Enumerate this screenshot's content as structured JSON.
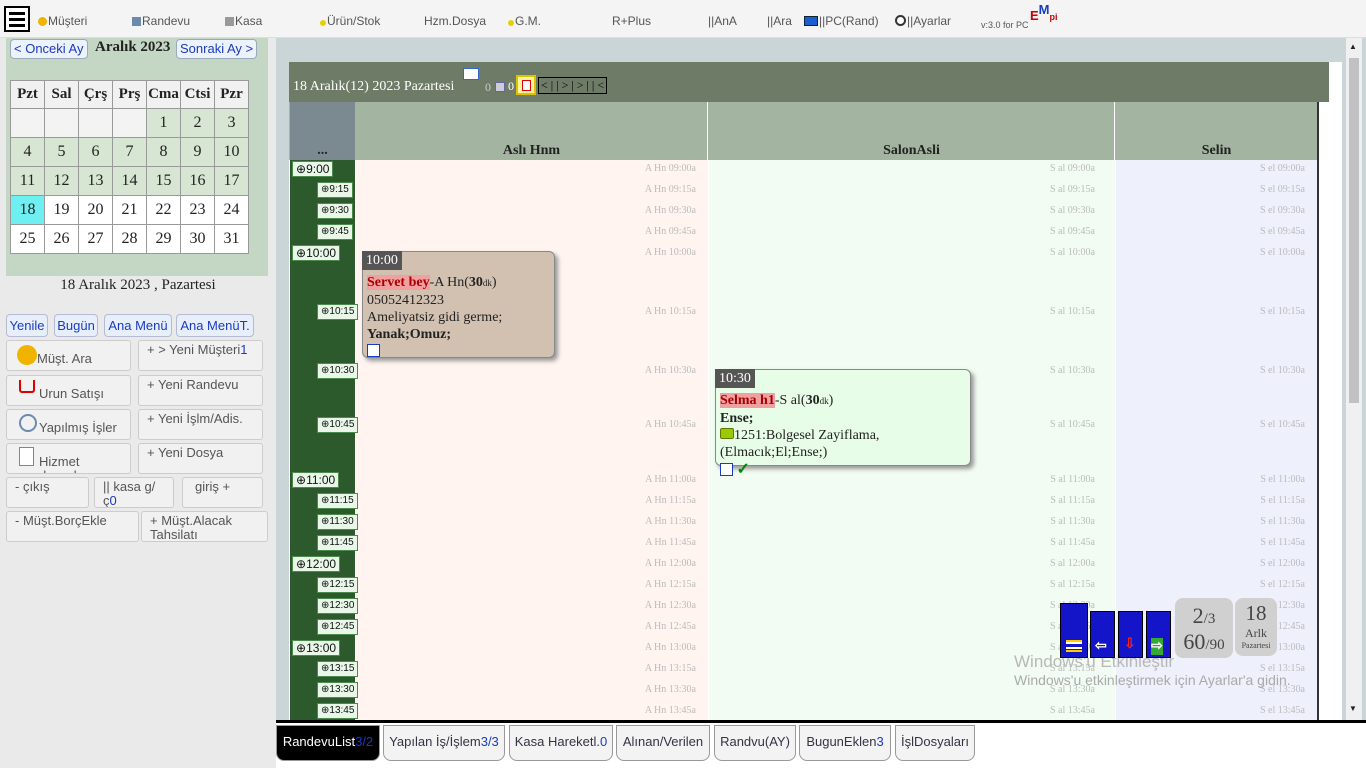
{
  "topbar": {
    "items": [
      "Müşteri",
      "Randevu",
      "Kasa",
      "Ürün/Stok",
      "Hzm.Dosya",
      "G.M.",
      "R+Plus",
      "||AnA",
      "||Ara",
      "||PC(Rand)",
      "||Ayarlar"
    ],
    "version": "v:3.0 for PC",
    "logo": "EMpi"
  },
  "calendar": {
    "prev": "< Onceki Ay",
    "next": "Sonraki Ay >",
    "month_title": "Aralık 2023",
    "weekdays": [
      "Pzt",
      "Sal",
      "Çrş",
      "Prş",
      "Cma",
      "Ctsi",
      "Pzr"
    ],
    "weeks": [
      [
        "",
        "",
        "",
        "",
        "1",
        "2",
        "3"
      ],
      [
        "4",
        "5",
        "6",
        "7",
        "8",
        "9",
        "10"
      ],
      [
        "11",
        "12",
        "13",
        "14",
        "15",
        "16",
        "17"
      ],
      [
        "18",
        "19",
        "20",
        "21",
        "22",
        "23",
        "24"
      ],
      [
        "25",
        "26",
        "27",
        "28",
        "29",
        "30",
        "31"
      ]
    ],
    "selected_date": "18 Aralık 2023 , Pazartesi"
  },
  "left_buttons": {
    "yenile": "Yenile",
    "bugun": "Bugün",
    "ana_menu": "Ana Menü",
    "ana_menu_t": "Ana MenüT.",
    "must_ara": "Müşt. Ara",
    "yeni_musteri": "+ > Yeni Müşteri",
    "yeni_musteri_count": "1",
    "urun_satisi": "Urun Satışı",
    "yeni_randevu": "+ Yeni Randevu",
    "yapilmis_isler": "Yapılmış İşler",
    "yeni_islm": "+ Yeni İşlm/Adis.",
    "hizmet_dosyalari": "Hizmet dosyaları",
    "yeni_dosya": "+ Yeni Dosya",
    "cikis": "- çıkış",
    "kasa_gc": "|| kasa g/ç",
    "kasa_gc_count": "0",
    "giris": "giriş +",
    "must_borc": "- Müşt.BorçEkle",
    "must_alacak": "+ Müşt.Alacak Tahsilatı"
  },
  "day_header": {
    "title": "18 Aralık(12) 2023 Pazartesi",
    "count_a": "0",
    "count_b": "0",
    "nav": "< | | > | > | | <"
  },
  "columns": {
    "corner": "...",
    "staff": [
      "Aslı Hnm",
      "SalonAsli",
      "Selin"
    ]
  },
  "time_slots": [
    "9:00",
    "9:15",
    "9:30",
    "9:45",
    "10:00",
    "10:15",
    "10:30",
    "10:45",
    "11:00",
    "11:15",
    "11:30",
    "11:45",
    "12:00",
    "12:15",
    "12:30",
    "12:45",
    "13:00",
    "13:15",
    "13:30",
    "13:45"
  ],
  "slot_labels": {
    "a": [
      "A Hn 09:00a",
      "A Hn 09:15a",
      "A Hn 09:30a",
      "A Hn 09:45a",
      "A Hn 10:00a",
      "A Hn 10:15a",
      "A Hn 10:30a",
      "A Hn 10:45a",
      "A Hn 11:00a",
      "A Hn 11:15a",
      "A Hn 11:30a",
      "A Hn 11:45a",
      "A Hn 12:00a",
      "A Hn 12:15a",
      "A Hn 12:30a",
      "A Hn 12:45a",
      "A Hn 13:00a",
      "A Hn 13:15a",
      "A Hn 13:30a",
      "A Hn 13:45a"
    ],
    "s": [
      "S al 09:00a",
      "S al 09:15a",
      "S al 09:30a",
      "S al 09:45a",
      "S al 10:00a",
      "S al 10:15a",
      "S al 10:30a",
      "S al 10:45a",
      "S al 11:00a",
      "S al 11:15a",
      "S al 11:30a",
      "S al 11:45a",
      "S al 12:00a",
      "S al 12:15a",
      "S al 12:30a",
      "S al 12:45a",
      "S al 13:00a",
      "S al 13:15a",
      "S al 13:30a",
      "S al 13:45a"
    ],
    "e": [
      "S el 09:00a",
      "S el 09:15a",
      "S el 09:30a",
      "S el 09:45a",
      "S el 10:00a",
      "S el 10:15a",
      "S el 10:30a",
      "S el 10:45a",
      "S el 11:00a",
      "S el 11:15a",
      "S el 11:30a",
      "S el 11:45a",
      "S el 12:00a",
      "S el 12:15a",
      "S el 12:30a",
      "S el 12:45a",
      "S el 13:00a",
      "S el 13:15a",
      "S el 13:30a",
      "S el 13:45a"
    ]
  },
  "appointments": [
    {
      "time": "10:00",
      "name": "Servet bey",
      "suffix": "-A Hn(",
      "duration": "30",
      "unit": "dk",
      "tail": ")",
      "phone": "05052412323",
      "note": "Ameliyatsiz gidi germe;",
      "area": "Yanak;Omuz;",
      "bg": "#d2c0b0"
    },
    {
      "time": "10:30",
      "name": "Selma h1",
      "suffix": "-S al(",
      "duration": "30",
      "unit": "dk",
      "tail": ")",
      "area": "Ense;",
      "service": "1251:Bolgesel Zayiflama,(Elmacık;El;Ense;)",
      "bg": "#e8fde8"
    }
  ],
  "widget": {
    "page": "2",
    "page_total": "/3",
    "progress": "60",
    "progress_total": "/90",
    "day": "18",
    "month": "Arlk",
    "weekday": "Pazartesi"
  },
  "watermark": {
    "line1": "Windows'u Etkinleştir",
    "line2": "Windows'u etkinleştirmek için Ayarlar'a gidin."
  },
  "tabs": [
    {
      "label": "RandevuList",
      "count": "3/2"
    },
    {
      "label": "Yapılan İş/İşlem",
      "count": "3/3"
    },
    {
      "label": "Kasa Hareketl.",
      "count": "0"
    },
    {
      "label": "Alınan/Verilen",
      "count": ""
    },
    {
      "label": "Randvu(AY)",
      "count": ""
    },
    {
      "label": "BugunEklen",
      "count": "3"
    },
    {
      "label": "İşlDosyaları",
      "count": ""
    }
  ],
  "colors": {
    "accent": "#1a3bbf",
    "header": "#6e7b66",
    "calendar_today": "#6ef0f2",
    "time_col": "#2d5a2d"
  }
}
